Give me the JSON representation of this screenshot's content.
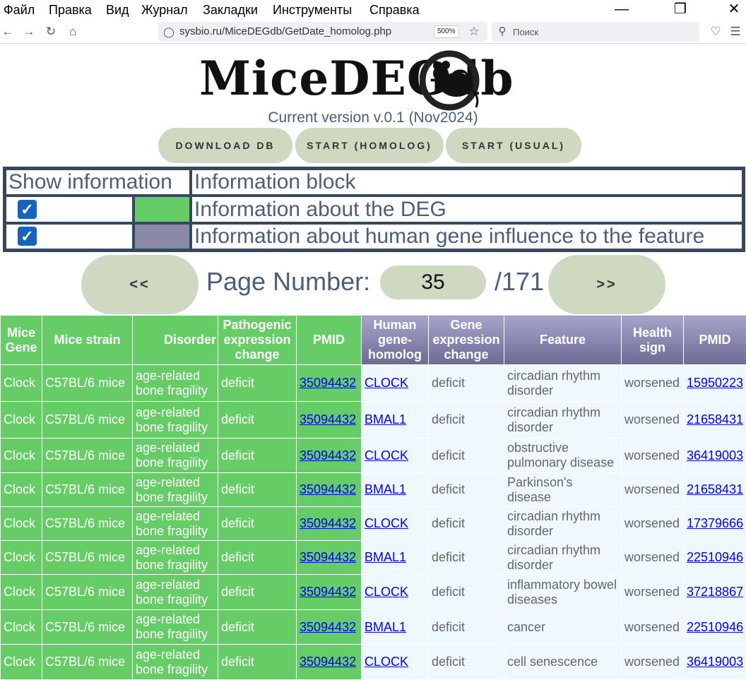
{
  "browser": {
    "menu": [
      "Файл",
      "Правка",
      "Вид",
      "Журнал",
      "Закладки",
      "Инструменты",
      "Справка"
    ],
    "url": "sysbio.ru/MiceDEGdb/GetDate_homolog.php",
    "zoom": "500%",
    "search_placeholder": "Поиск"
  },
  "header": {
    "logo_text": "MiceDEGdb",
    "version": "Current version v.0.1 (Nov2024)",
    "buttons": [
      "DOWNLOAD DB",
      "START (HOMOLOG)",
      "START (USUAL)"
    ]
  },
  "info_table": {
    "col1_header": "Show information",
    "col2_header": "Information block",
    "rows": [
      {
        "checked": true,
        "color": "#66cc66",
        "label": "Information about the DEG"
      },
      {
        "checked": true,
        "color": "#8a89a8",
        "label": "Information about human gene influence to the feature"
      }
    ]
  },
  "pager": {
    "prev": "<<",
    "next": ">>",
    "label": "Page Number:",
    "current": "35",
    "total": "/171"
  },
  "table": {
    "headers": [
      "Mice Gene",
      "Mice strain",
      "Disorder",
      "Pathogenic expression change",
      "PMID",
      "Human gene-homolog",
      "Gene expression change",
      "Feature",
      "Health sign",
      "PMID"
    ],
    "rows": [
      [
        "Clock",
        "C57BL/6 mice",
        "age-related bone fragility",
        "deficit",
        "35094432",
        "CLOCK",
        "deficit",
        "circadian rhythm disorder",
        "worsened",
        "15950223"
      ],
      [
        "Clock",
        "C57BL/6 mice",
        "age-related bone fragility",
        "deficit",
        "35094432",
        "BMAL1",
        "deficit",
        "circadian rhythm disorder",
        "worsened",
        "21658431"
      ],
      [
        "Clock",
        "C57BL/6 mice",
        "age-related bone fragility",
        "deficit",
        "35094432",
        "CLOCK",
        "deficit",
        "obstructive pulmonary disease",
        "worsened",
        "36419003"
      ],
      [
        "Clock",
        "C57BL/6 mice",
        "age-related bone fragility",
        "deficit",
        "35094432",
        "BMAL1",
        "deficit",
        "Parkinson's disease",
        "worsened",
        "21658431"
      ],
      [
        "Clock",
        "C57BL/6 mice",
        "age-related bone fragility",
        "deficit",
        "35094432",
        "CLOCK",
        "deficit",
        "circadian rhythm disorder",
        "worsened",
        "17379666"
      ],
      [
        "Clock",
        "C57BL/6 mice",
        "age-related bone fragility",
        "deficit",
        "35094432",
        "BMAL1",
        "deficit",
        "circadian rhythm disorder",
        "worsened",
        "22510946"
      ],
      [
        "Clock",
        "C57BL/6 mice",
        "age-related bone fragility",
        "deficit",
        "35094432",
        "CLOCK",
        "deficit",
        "inflammatory bowel diseases",
        "worsened",
        "37218867"
      ],
      [
        "Clock",
        "C57BL/6 mice",
        "age-related bone fragility",
        "deficit",
        "35094432",
        "BMAL1",
        "deficit",
        "cancer",
        "worsened",
        "22510946"
      ],
      [
        "Clock",
        "C57BL/6 mice",
        "age-related bone fragility",
        "deficit",
        "35094432",
        "CLOCK",
        "deficit",
        "cell senescence",
        "worsened",
        "36419003"
      ]
    ]
  }
}
